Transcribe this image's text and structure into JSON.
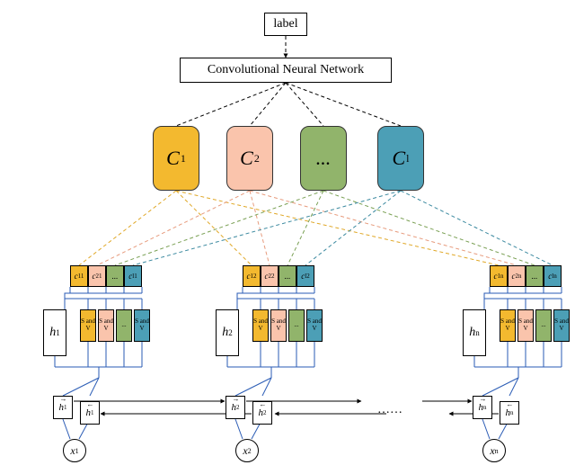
{
  "top": {
    "label": "label",
    "cnn": "Convolutional Neural Network"
  },
  "capsules": {
    "c1": "C",
    "c1_sub": "1",
    "c2": "C",
    "c2_sub": "2",
    "c3": "...",
    "cl": "C",
    "cl_sub": "l"
  },
  "groups": [
    {
      "minis": [
        {
          "t": "c",
          "s": "11",
          "col": "col-yellow"
        },
        {
          "t": "c",
          "s": "21",
          "col": "col-peach"
        },
        {
          "t": "...",
          "s": "",
          "col": "col-green"
        },
        {
          "t": "c",
          "s": "l1",
          "col": "col-teal"
        }
      ],
      "h": "h",
      "h_sub": "1",
      "fwd": "h",
      "fwd_sub": "1",
      "bwd": "h",
      "bwd_sub": "1",
      "x": "x",
      "x_sub": "1"
    },
    {
      "minis": [
        {
          "t": "c",
          "s": "12",
          "col": "col-yellow"
        },
        {
          "t": "c",
          "s": "22",
          "col": "col-peach"
        },
        {
          "t": "...",
          "s": "",
          "col": "col-green"
        },
        {
          "t": "c",
          "s": "l2",
          "col": "col-teal"
        }
      ],
      "h": "h",
      "h_sub": "2",
      "fwd": "h",
      "fwd_sub": "2",
      "bwd": "h",
      "bwd_sub": "2",
      "x": "x",
      "x_sub": "2"
    },
    {
      "minis": [
        {
          "t": "c",
          "s": "1n",
          "col": "col-yellow"
        },
        {
          "t": "c",
          "s": "2n",
          "col": "col-peach"
        },
        {
          "t": "...",
          "s": "",
          "col": "col-green"
        },
        {
          "t": "c",
          "s": "ln",
          "col": "col-teal"
        }
      ],
      "h": "h",
      "h_sub": "n",
      "fwd": "h",
      "fwd_sub": "n",
      "bwd": "h",
      "bwd_sub": "n",
      "x": "x",
      "x_sub": "n"
    }
  ],
  "sv": "S\nand\nV",
  "dots_wide": "……"
}
